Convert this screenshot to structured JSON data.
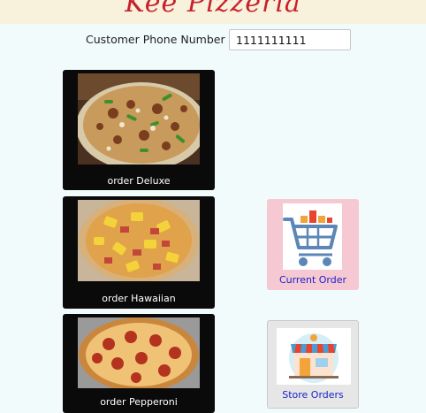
{
  "header": {
    "brand": "Kee Pizzeria"
  },
  "phone": {
    "label": "Customer Phone Number",
    "value": "1111111111"
  },
  "pizzas": [
    {
      "label": "order Deluxe",
      "image": "deluxe-pizza-photo"
    },
    {
      "label": "order Hawaiian",
      "image": "hawaiian-pizza-photo"
    },
    {
      "label": "order Pepperoni",
      "image": "pepperoni-pizza-photo"
    }
  ],
  "actions": {
    "current_order": {
      "label": "Current Order",
      "icon": "shopping-cart-icon"
    },
    "store_orders": {
      "label": "Store Orders",
      "icon": "storefront-icon"
    }
  },
  "colors": {
    "background": "#f2fbfc",
    "header": "#f8f2dc",
    "brand": "#c8202c",
    "card": "#0a0a0a",
    "current_order_card": "#f6c8d2",
    "store_orders_card": "#e6e6e6",
    "action_text": "#1a22c8"
  }
}
